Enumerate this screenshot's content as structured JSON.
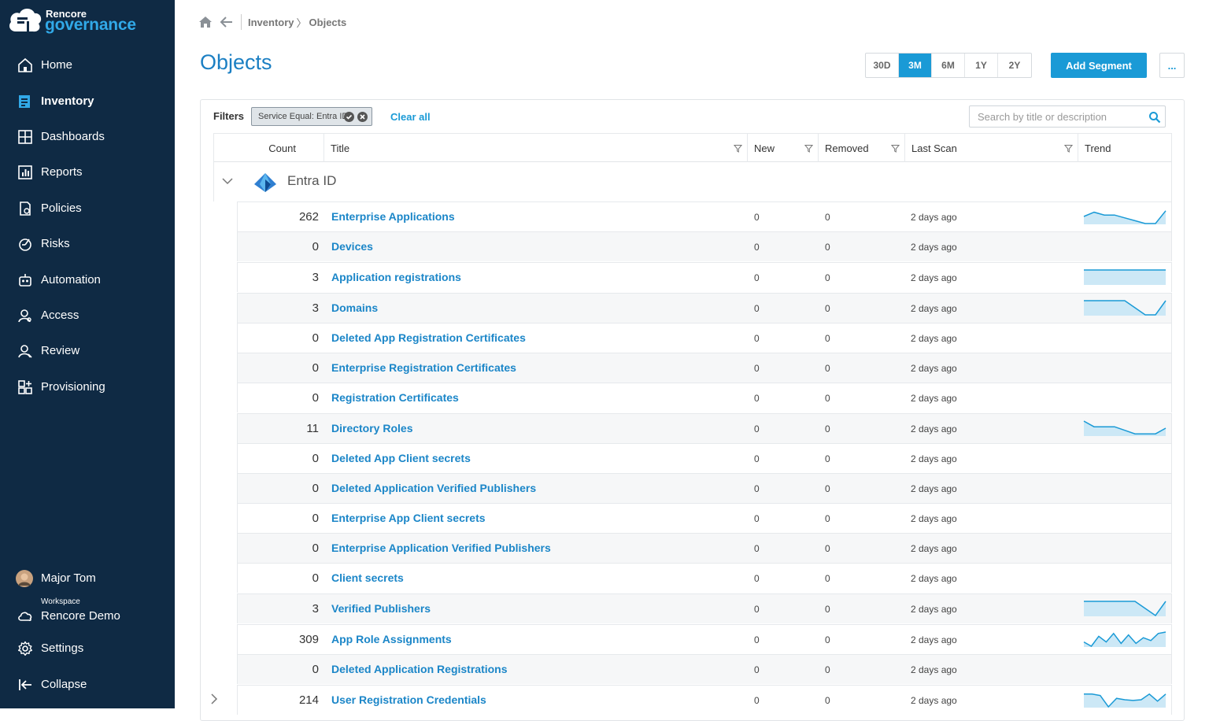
{
  "brand": {
    "small": "Rencore",
    "big": "governance"
  },
  "nav": [
    {
      "label": "Home",
      "icon": "home-icon",
      "active": false
    },
    {
      "label": "Inventory",
      "icon": "inventory-icon",
      "active": true
    },
    {
      "label": "Dashboards",
      "icon": "dashboard-icon",
      "active": false
    },
    {
      "label": "Reports",
      "icon": "reports-icon",
      "active": false
    },
    {
      "label": "Policies",
      "icon": "policies-icon",
      "active": false
    },
    {
      "label": "Risks",
      "icon": "risks-icon",
      "active": false
    },
    {
      "label": "Automation",
      "icon": "robot-icon",
      "active": false
    },
    {
      "label": "Access",
      "icon": "access-icon",
      "active": false
    },
    {
      "label": "Review",
      "icon": "review-icon",
      "active": false
    },
    {
      "label": "Provisioning",
      "icon": "provisioning-icon",
      "active": false
    }
  ],
  "footer": {
    "user": "Major Tom",
    "workspace_caption": "Workspace",
    "workspace_name": "Rencore Demo",
    "settings": "Settings",
    "collapse": "Collapse"
  },
  "breadcrumb": {
    "parent": "Inventory",
    "separator": "〉",
    "current": "Objects"
  },
  "page_title": "Objects",
  "ranges": [
    {
      "label": "30D",
      "selected": false
    },
    {
      "label": "3M",
      "selected": true
    },
    {
      "label": "6M",
      "selected": false
    },
    {
      "label": "1Y",
      "selected": false
    },
    {
      "label": "2Y",
      "selected": false
    }
  ],
  "add_segment": "Add Segment",
  "more": "...",
  "filters": {
    "label": "Filters",
    "chip": "Service Equal: Entra ID",
    "clear_all": "Clear all",
    "search_placeholder": "Search by title or description"
  },
  "columns": {
    "count": "Count",
    "title": "Title",
    "new": "New",
    "removed": "Removed",
    "last_scan": "Last Scan",
    "trend": "Trend"
  },
  "group": {
    "name": "Entra ID"
  },
  "colors": {
    "accent": "#1a9ad6",
    "sidebar": "#0f2a44",
    "link": "#1b86c8",
    "trend_fill": "#cce8f6"
  },
  "rows": [
    {
      "count": "262",
      "title": "Enterprise Applications",
      "new": "0",
      "removed": "0",
      "last_scan": "2 days ago",
      "trend": [
        0.5,
        0.8,
        0.6,
        0.6,
        0.4,
        0.2,
        0.0,
        0.0,
        0.9
      ]
    },
    {
      "count": "0",
      "title": "Devices",
      "new": "0",
      "removed": "0",
      "last_scan": "2 days ago",
      "trend": null
    },
    {
      "count": "3",
      "title": "Application registrations",
      "new": "0",
      "removed": "0",
      "last_scan": "2 days ago",
      "trend": [
        1,
        1,
        1,
        1,
        1,
        1,
        1,
        1,
        1
      ]
    },
    {
      "count": "3",
      "title": "Domains",
      "new": "0",
      "removed": "0",
      "last_scan": "2 days ago",
      "trend": [
        1,
        1,
        1,
        1,
        1,
        0.5,
        0,
        0,
        1
      ]
    },
    {
      "count": "0",
      "title": "Deleted App Registration Certificates",
      "new": "0",
      "removed": "0",
      "last_scan": "2 days ago",
      "trend": null
    },
    {
      "count": "0",
      "title": "Enterprise Registration Certificates",
      "new": "0",
      "removed": "0",
      "last_scan": "2 days ago",
      "trend": null
    },
    {
      "count": "0",
      "title": "Registration Certificates",
      "new": "0",
      "removed": "0",
      "last_scan": "2 days ago",
      "trend": null
    },
    {
      "count": "11",
      "title": "Directory Roles",
      "new": "0",
      "removed": "0",
      "last_scan": "2 days ago",
      "trend": [
        1,
        0.6,
        0.6,
        0.6,
        0.35,
        0.1,
        0.1,
        0.1,
        0.5
      ]
    },
    {
      "count": "0",
      "title": "Deleted App Client secrets",
      "new": "0",
      "removed": "0",
      "last_scan": "2 days ago",
      "trend": null
    },
    {
      "count": "0",
      "title": "Deleted Application Verified Publishers",
      "new": "0",
      "removed": "0",
      "last_scan": "2 days ago",
      "trend": null
    },
    {
      "count": "0",
      "title": "Enterprise App Client secrets",
      "new": "0",
      "removed": "0",
      "last_scan": "2 days ago",
      "trend": null
    },
    {
      "count": "0",
      "title": "Enterprise Application Verified Publishers",
      "new": "0",
      "removed": "0",
      "last_scan": "2 days ago",
      "trend": null
    },
    {
      "count": "0",
      "title": "Client secrets",
      "new": "0",
      "removed": "0",
      "last_scan": "2 days ago",
      "trend": null
    },
    {
      "count": "3",
      "title": "Verified Publishers",
      "new": "0",
      "removed": "0",
      "last_scan": "2 days ago",
      "trend": [
        1,
        1,
        1,
        1,
        1,
        1,
        0.5,
        0,
        1
      ]
    },
    {
      "count": "309",
      "title": "App Role Assignments",
      "new": "0",
      "removed": "0",
      "last_scan": "2 days ago",
      "trend": [
        0.3,
        0.0,
        0.7,
        0.3,
        0.9,
        0.2,
        0.8,
        0.2,
        0.6,
        0.4,
        0.9,
        1.0
      ]
    },
    {
      "count": "0",
      "title": "Deleted Application Registrations",
      "new": "0",
      "removed": "0",
      "last_scan": "2 days ago",
      "trend": null
    },
    {
      "count": "214",
      "title": "User Registration Credentials",
      "new": "0",
      "removed": "0",
      "last_scan": "2 days ago",
      "trend": [
        0.9,
        0.9,
        0.8,
        0.0,
        0.6,
        0.5,
        0.45,
        0.5,
        0.9,
        0.4,
        0.9
      ],
      "expandable": true
    }
  ]
}
